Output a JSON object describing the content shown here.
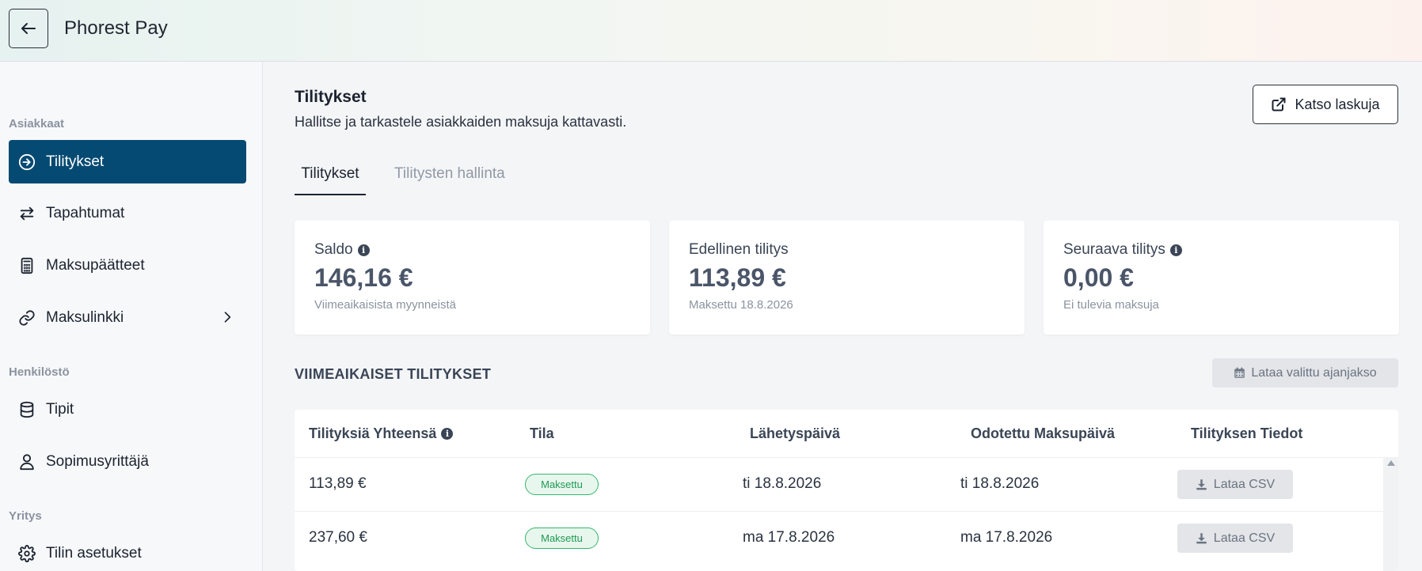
{
  "app": {
    "title": "Phorest Pay"
  },
  "sidebar": {
    "sections": [
      {
        "label": "Asiakkaat"
      },
      {
        "label": "Henkilöstö"
      },
      {
        "label": "Yritys"
      }
    ],
    "items": [
      {
        "label": "Tilitykset",
        "icon": "arrow-circle-right-icon",
        "active": true
      },
      {
        "label": "Tapahtumat",
        "icon": "swap-arrows-icon"
      },
      {
        "label": "Maksupäätteet",
        "icon": "calculator-icon"
      },
      {
        "label": "Maksulinkki",
        "icon": "link-icon",
        "has_submenu": true
      },
      {
        "label": "Tipit",
        "icon": "database-icon"
      },
      {
        "label": "Sopimusyrittäjä",
        "icon": "user-icon"
      },
      {
        "label": "Tilin asetukset",
        "icon": "gear-icon"
      }
    ]
  },
  "header": {
    "title": "Tilitykset",
    "subtitle": "Hallitse ja tarkastele asiakkaiden maksuja kattavasti.",
    "invoices_button": "Katso laskuja"
  },
  "tabs": [
    {
      "label": "Tilitykset",
      "active": true
    },
    {
      "label": "Tilitysten hallinta",
      "active": false
    }
  ],
  "cards": [
    {
      "label": "Saldo",
      "info": true,
      "value": "146,16 €",
      "sub": "Viimeaikaisista myynneistä"
    },
    {
      "label": "Edellinen tilitys",
      "info": false,
      "value": "113,89 €",
      "sub": "Maksettu 18.8.2026"
    },
    {
      "label": "Seuraava tilitys",
      "info": true,
      "value": "0,00 €",
      "sub": "Ei tulevia maksuja"
    }
  ],
  "recent": {
    "title": "VIIMEAIKAISET TILITYKSET",
    "download_period_button": "Lataa valittu ajanjakso",
    "columns": [
      "Tilityksiä Yhteensä",
      "Tila",
      "Lähetyspäivä",
      "Odotettu Maksupäivä",
      "Tilityksen Tiedot"
    ],
    "rows": [
      {
        "total": "113,89 €",
        "status": "Maksettu",
        "sent": "ti 18.8.2026",
        "expected": "ti 18.8.2026",
        "action": "Lataa CSV"
      },
      {
        "total": "237,60 €",
        "status": "Maksettu",
        "sent": "ma 17.8.2026",
        "expected": "ma 17.8.2026",
        "action": "Lataa CSV"
      }
    ]
  },
  "colors": {
    "active_nav": "#054a72",
    "status_paid": "#1f9a52",
    "value_text": "#4a5568"
  }
}
